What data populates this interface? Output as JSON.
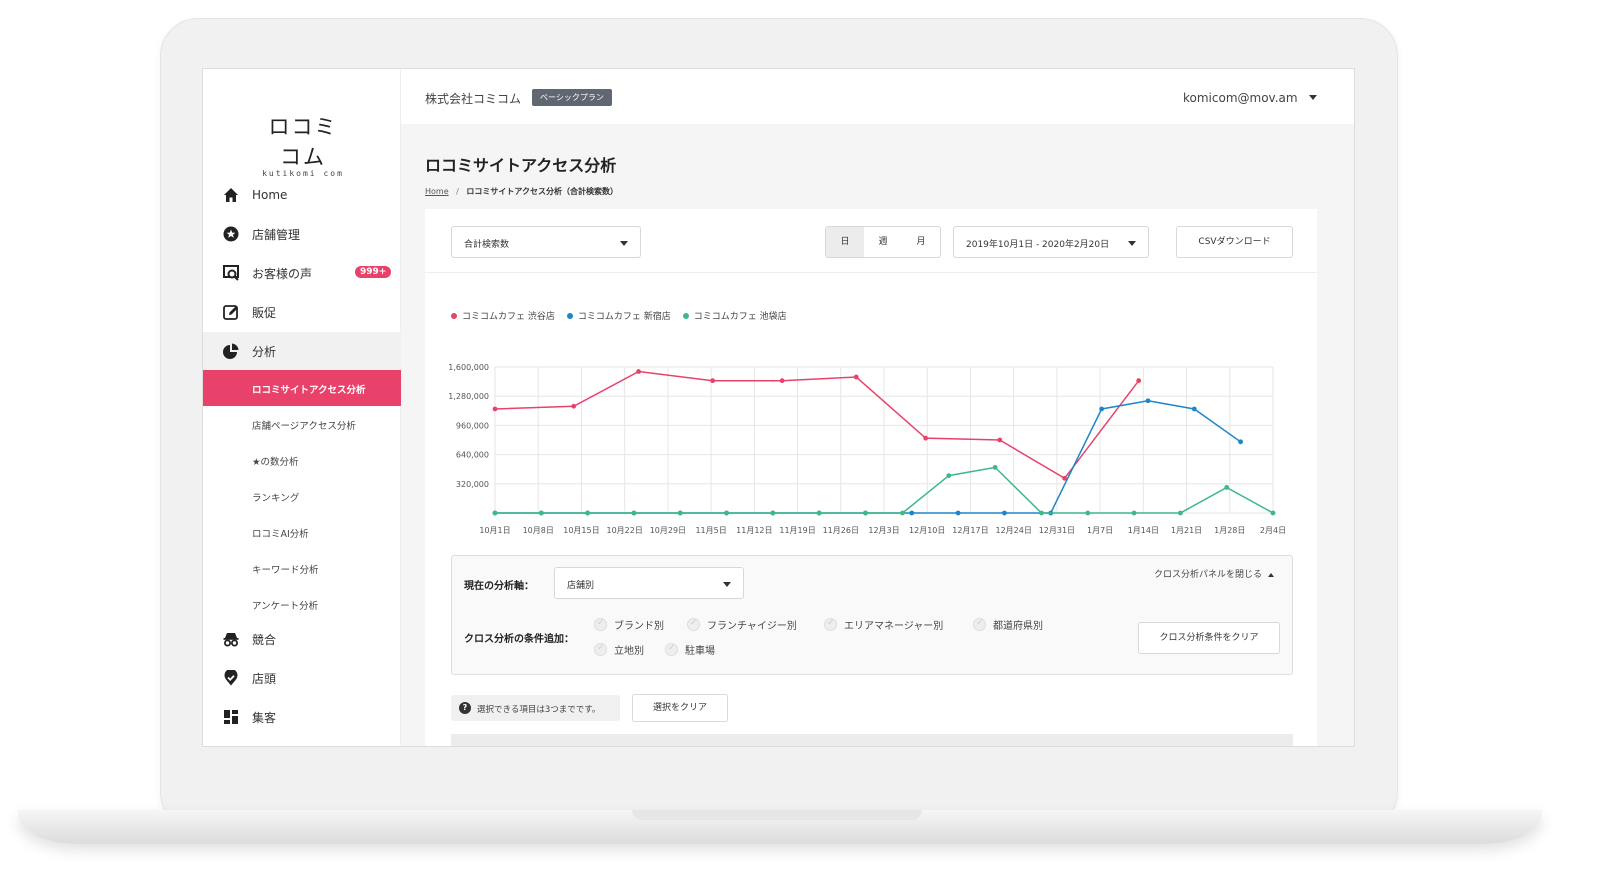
{
  "logo": {
    "mark": "ロコミコム",
    "sub": "kutikomi com"
  },
  "header": {
    "company": "株式会社コミコム",
    "plan": "ベーシックプラン",
    "email": "komicom@mov.am"
  },
  "sidebar": {
    "items": [
      {
        "label": "Home",
        "icon": "home-icon"
      },
      {
        "label": "店舗管理",
        "icon": "star-icon"
      },
      {
        "label": "お客様の声",
        "icon": "review-icon",
        "badge": "999+"
      },
      {
        "label": "販促",
        "icon": "edit-icon"
      },
      {
        "label": "分析",
        "icon": "pie-chart-icon"
      },
      {
        "label": "競合",
        "icon": "spy-icon"
      },
      {
        "label": "店頭",
        "icon": "location-icon"
      },
      {
        "label": "集客",
        "icon": "dashboard-icon"
      }
    ],
    "sub_items": [
      "ロコミサイトアクセス分析",
      "店舗ページアクセス分析",
      "★の数分析",
      "ランキング",
      "ロコミAI分析",
      "キーワード分析",
      "アンケート分析"
    ]
  },
  "page": {
    "title": "ロコミサイトアクセス分析",
    "breadcrumb_home": "Home",
    "breadcrumb_sep": "/",
    "breadcrumb_current": "ロコミサイトアクセス分析（合計検索数）"
  },
  "toolbar": {
    "metric": "合計検索数",
    "periods": [
      "日",
      "週",
      "月"
    ],
    "date_range": "2019年10月1日 - 2020年2月20日",
    "csv": "CSVダウンロード"
  },
  "chart_data": {
    "type": "line",
    "categories": [
      "10月1日",
      "10月8日",
      "10月15日",
      "10月22日",
      "10月29日",
      "11月5日",
      "11月12日",
      "11月19日",
      "11月26日",
      "12月3日",
      "12月10日",
      "12月17日",
      "12月24日",
      "12月31日",
      "1月7日",
      "1月14日",
      "1月21日",
      "1月28日",
      "2月4日"
    ],
    "yticks": [
      "1,600,000",
      "1,280,000",
      "960,000",
      "640,000",
      "320,000"
    ],
    "ylim": [
      0,
      1600000
    ],
    "series": [
      {
        "name": "コミコムカフェ 渋谷店",
        "color": "#e8426b",
        "points": [
          [
            0,
            1140000
          ],
          [
            1.7,
            1170000
          ],
          [
            3.1,
            1550000
          ],
          [
            4.7,
            1450000
          ],
          [
            6.2,
            1450000
          ],
          [
            7.8,
            1490000
          ],
          [
            9.3,
            820000
          ],
          [
            10.9,
            800000
          ],
          [
            12.3,
            380000
          ],
          [
            13.9,
            1450000
          ]
        ]
      },
      {
        "name": "コミコムカフェ 新宿店",
        "color": "#1b86c8",
        "points": [
          [
            0,
            0
          ],
          [
            1,
            0
          ],
          [
            2,
            0
          ],
          [
            3,
            0
          ],
          [
            4,
            0
          ],
          [
            5,
            0
          ],
          [
            6,
            0
          ],
          [
            7,
            0
          ],
          [
            8,
            0
          ],
          [
            9,
            0
          ],
          [
            10,
            0
          ],
          [
            11,
            0
          ],
          [
            12,
            0
          ],
          [
            13.1,
            1140000
          ],
          [
            14.1,
            1230000
          ],
          [
            15.1,
            1140000
          ],
          [
            16.1,
            780000
          ]
        ]
      },
      {
        "name": "コミコムカフェ 池袋店",
        "color": "#3cb88a",
        "points": [
          [
            0,
            0
          ],
          [
            1,
            0
          ],
          [
            2,
            0
          ],
          [
            3,
            0
          ],
          [
            4,
            0
          ],
          [
            5,
            0
          ],
          [
            6,
            0
          ],
          [
            7,
            0
          ],
          [
            8,
            0
          ],
          [
            8.8,
            0
          ],
          [
            9.8,
            410000
          ],
          [
            10.8,
            500000
          ],
          [
            11.8,
            0
          ],
          [
            12.8,
            0
          ],
          [
            13.8,
            0
          ],
          [
            14.8,
            0
          ],
          [
            15.8,
            280000
          ],
          [
            16.8,
            0
          ]
        ]
      }
    ],
    "x_span": 16.8,
    "grid": true,
    "legend": "top-left"
  },
  "panel": {
    "axis_label": "現在の分析軸：",
    "axis_value": "店舗別",
    "close": "クロス分析パネルを閉じる",
    "cond_label": "クロス分析の条件追加：",
    "options": [
      "ブランド別",
      "フランチャイジー別",
      "エリアマネージャー別",
      "都道府県別",
      "立地別",
      "駐車場"
    ],
    "clear_cross": "クロス分析条件をクリア"
  },
  "bottom": {
    "hint": "選択できる項目は3つまでです。",
    "hint_icon": "?",
    "clear": "選択をクリア"
  }
}
